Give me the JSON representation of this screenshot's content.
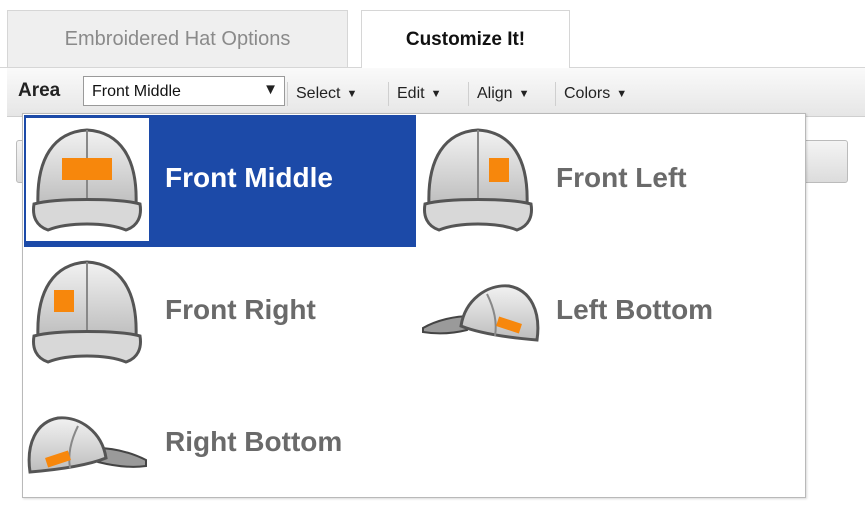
{
  "tabs": [
    {
      "label": "Embroidered Hat Options",
      "active": false
    },
    {
      "label": "Customize It!",
      "active": true
    }
  ],
  "toolbar": {
    "area_label": "Area",
    "area_value": "Front Middle",
    "menus": [
      "Select",
      "Edit",
      "Align",
      "Colors"
    ]
  },
  "dropdown": {
    "options": [
      {
        "label": "Front Middle",
        "icon": "cap-front-middle-icon",
        "selected": true
      },
      {
        "label": "Front Left",
        "icon": "cap-front-left-icon",
        "selected": false
      },
      {
        "label": "Front Right",
        "icon": "cap-front-right-icon",
        "selected": false
      },
      {
        "label": "Left Bottom",
        "icon": "cap-left-side-icon",
        "selected": false
      },
      {
        "label": "Right Bottom",
        "icon": "cap-right-side-icon",
        "selected": false
      }
    ]
  },
  "colors": {
    "selected_bg": "#1c4aa8",
    "patch": "#f7870c",
    "option_text": "#6a6a6a"
  }
}
